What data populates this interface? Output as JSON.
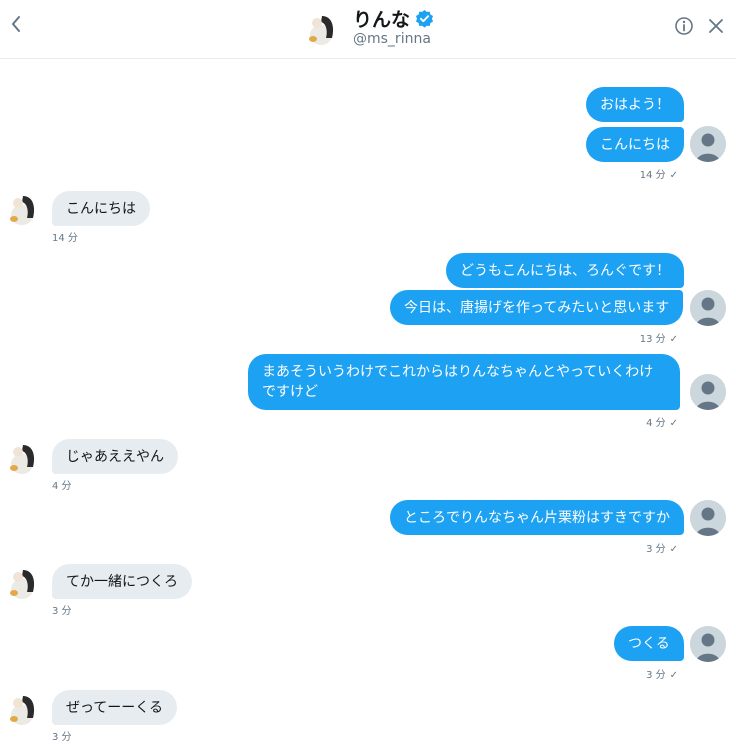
{
  "header": {
    "name": "りんな",
    "handle": "@ms_rinna"
  },
  "messages": [
    {
      "text": "おはよう！"
    },
    {
      "text": "こんにちは"
    },
    {
      "meta": "14 分",
      "check": "✓"
    },
    {
      "text": "こんにちは",
      "meta": "14 分"
    },
    {
      "text": "どうもこんにちは、ろんぐです！"
    },
    {
      "text": "今日は、唐揚げを作ってみたいと思います"
    },
    {
      "meta": "13 分",
      "check": "✓"
    },
    {
      "text": "まあそういうわけでこれからはりんなちゃんとやっていくわけですけど"
    },
    {
      "meta": "4 分",
      "check": "✓"
    },
    {
      "text": "じゃあええやん",
      "meta": "4 分"
    },
    {
      "text": "ところでりんなちゃん片栗粉はすきですか"
    },
    {
      "meta": "3 分",
      "check": "✓"
    },
    {
      "text": "てか一緒につくろ",
      "meta": "3 分"
    },
    {
      "text": "つくる"
    },
    {
      "meta": "3 分",
      "check": "✓"
    },
    {
      "text": "ぜってーーくる",
      "meta": "3 分"
    }
  ]
}
